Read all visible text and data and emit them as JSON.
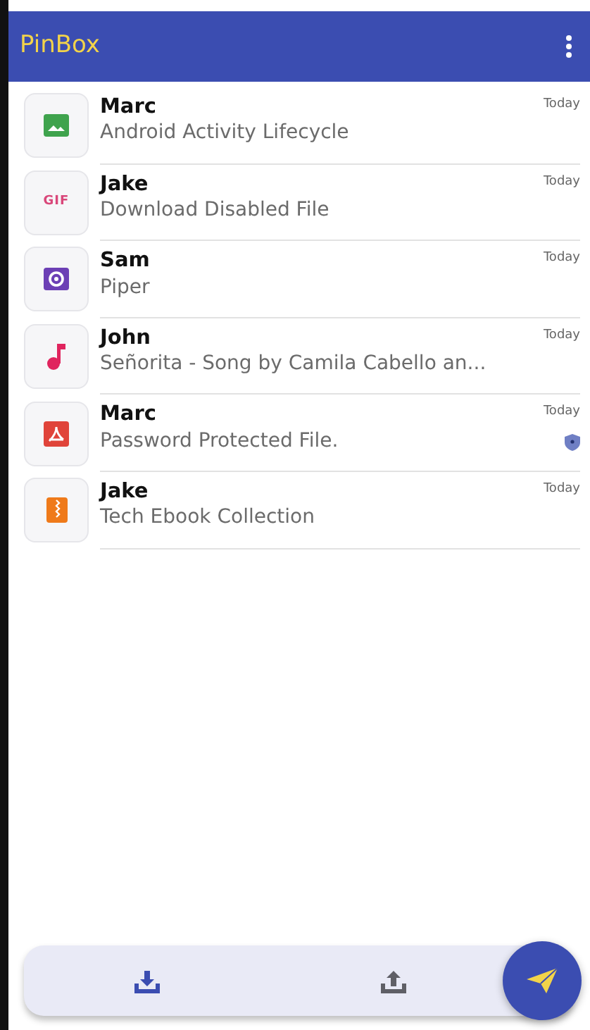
{
  "app_bar": {
    "title": "PinBox"
  },
  "items": [
    {
      "sender": "Marc",
      "title": "Android Activity Lifecycle",
      "time": "Today",
      "kind": "image",
      "color": "#3fa34d",
      "protected": false
    },
    {
      "sender": "Jake",
      "title": "Download Disabled File",
      "time": "Today",
      "kind": "gif",
      "color": "#d9477a",
      "protected": false,
      "icon_text": "GIF"
    },
    {
      "sender": "Sam",
      "title": "Piper",
      "time": "Today",
      "kind": "media",
      "color": "#6c3fb5",
      "protected": false
    },
    {
      "sender": "John",
      "title": "Señorita - Song by Camila Cabello an...",
      "time": "Today",
      "kind": "music",
      "color": "#e0245e",
      "protected": false
    },
    {
      "sender": "Marc",
      "title": "Password Protected File.",
      "time": "Today",
      "kind": "pdf",
      "color": "#e0443a",
      "protected": true
    },
    {
      "sender": "Jake",
      "title": "Tech Ebook Collection",
      "time": "Today",
      "kind": "zip",
      "color": "#ef7a1a",
      "protected": false
    }
  ],
  "bottom_nav": [
    {
      "kind": "download",
      "selected": true
    },
    {
      "kind": "upload",
      "selected": false
    }
  ]
}
